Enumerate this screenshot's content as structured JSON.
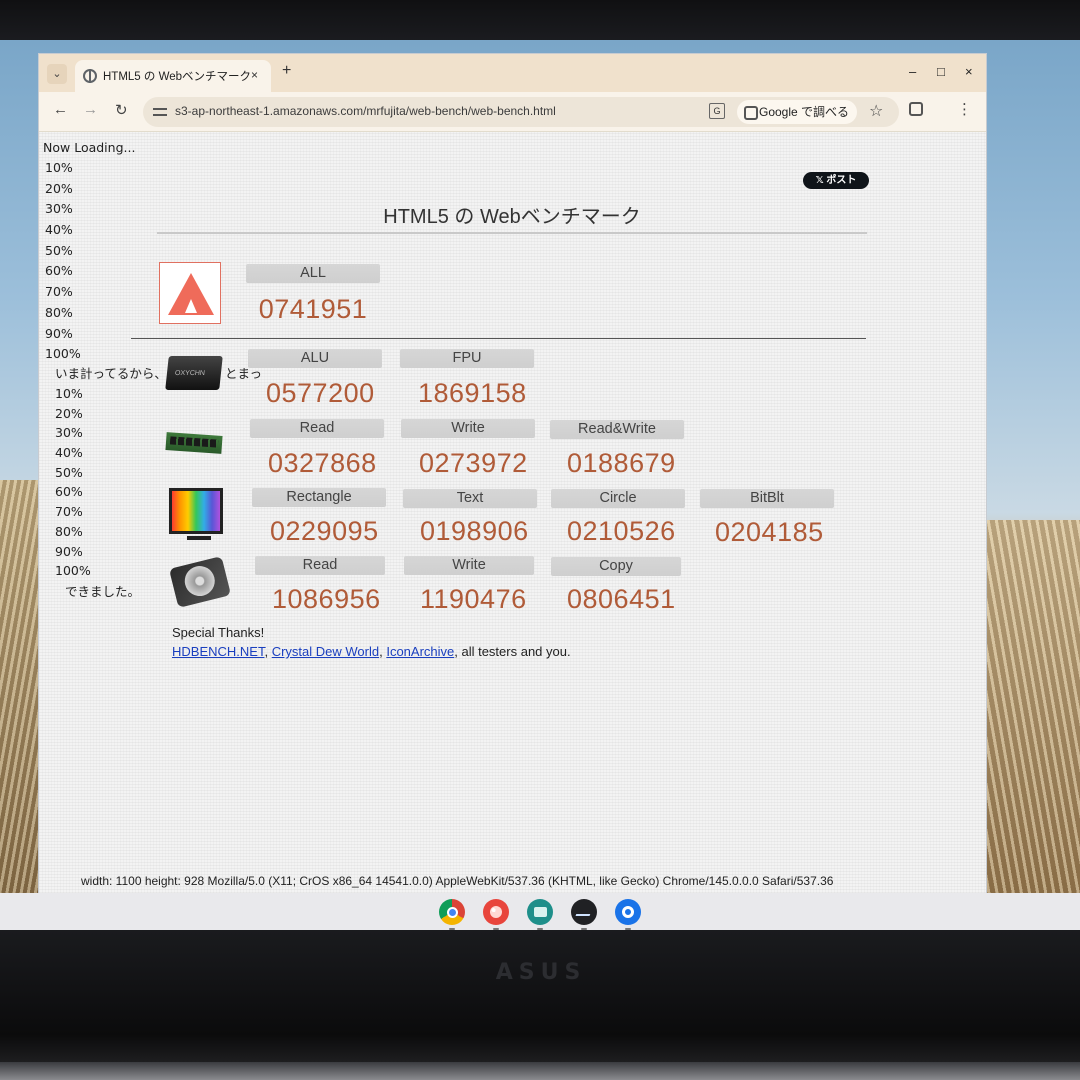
{
  "browser": {
    "tab_title": "HTML5 の Webベンチマーク",
    "tab_close": "×",
    "new_tab": "+",
    "menu_chevron": "⌄",
    "win_minimize": "–",
    "win_maximize": "□",
    "win_close": "×",
    "nav_back": "←",
    "nav_forward": "→",
    "nav_reload": "↻",
    "url": "s3-ap-northeast-1.amazonaws.com/mrfujita/web-bench/web-bench.html",
    "translate_glyph": "G",
    "google_search_label": "Google で調べる",
    "bookmark_star": "☆",
    "menu_dots": "⋮"
  },
  "page": {
    "loading_text": "Now Loading...",
    "progress_first": [
      "10%",
      "20%",
      "30%",
      "40%",
      "50%",
      "60%",
      "70%",
      "80%",
      "90%",
      "100%"
    ],
    "measuring_text": "いま計ってるから、",
    "measuring_trailing": "とまっ",
    "progress_second": [
      "10%",
      "20%",
      "30%",
      "40%",
      "50%",
      "60%",
      "70%",
      "80%",
      "90%",
      "100%"
    ],
    "done_text": "できました。",
    "post_button": "𝕏 ポスト",
    "title": "HTML5 の Webベンチマーク",
    "cpu_icon_text": "OXYCHN",
    "all": {
      "label": "ALL",
      "score": "0741951"
    },
    "cpu": [
      {
        "label": "ALU",
        "score": "0577200"
      },
      {
        "label": "FPU",
        "score": "1869158"
      }
    ],
    "memory": [
      {
        "label": "Read",
        "score": "0327868"
      },
      {
        "label": "Write",
        "score": "0273972"
      },
      {
        "label": "Read&Write",
        "score": "0188679"
      }
    ],
    "graphics": [
      {
        "label": "Rectangle",
        "score": "0229095"
      },
      {
        "label": "Text",
        "score": "0198906"
      },
      {
        "label": "Circle",
        "score": "0210526"
      },
      {
        "label": "BitBlt",
        "score": "0204185"
      }
    ],
    "storage": [
      {
        "label": "Read",
        "score": "1086956"
      },
      {
        "label": "Write",
        "score": "1190476"
      },
      {
        "label": "Copy",
        "score": "0806451"
      }
    ],
    "thanks_heading": "Special Thanks!",
    "thanks_links": [
      "HDBENCH.NET",
      "Crystal Dew World",
      "IconArchive"
    ],
    "thanks_sep": ", ",
    "thanks_tail": ", all testers and you.",
    "user_agent": "width: 1100 height: 928 Mozilla/5.0 (X11; CrOS x86_64 14541.0.0) AppleWebKit/537.36 (KHTML, like Gecko) Chrome/145.0.0.0 Safari/537.36"
  },
  "device": {
    "brand": "ASUS"
  }
}
